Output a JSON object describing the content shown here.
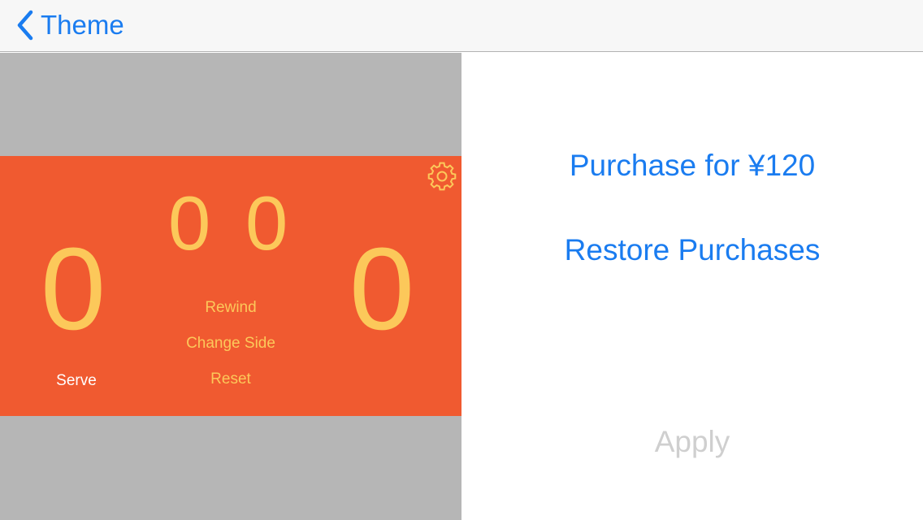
{
  "nav": {
    "back_label": "Theme"
  },
  "preview": {
    "score_left": "0",
    "score_right": "0",
    "set_left": "0",
    "set_right": "0",
    "rewind_label": "Rewind",
    "change_side_label": "Change Side",
    "reset_label": "Reset",
    "serve_label": "Serve",
    "icons": {
      "settings": "gear-icon"
    }
  },
  "panel": {
    "purchase_label": "Purchase for ¥120",
    "restore_label": "Restore Purchases",
    "apply_label": "Apply"
  },
  "colors": {
    "accent": "#1a7cf0",
    "board_background": "#f05a30",
    "score_color": "#fcc85a",
    "preview_background": "#b6b6b6",
    "disabled_text": "#cfcfcf"
  }
}
